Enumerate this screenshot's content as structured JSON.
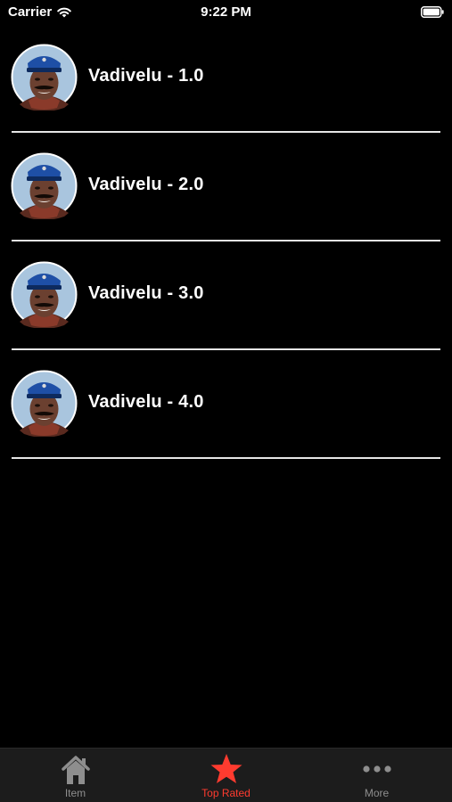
{
  "status_bar": {
    "carrier": "Carrier",
    "time": "9:22 PM"
  },
  "items": [
    {
      "label": "Vadivelu - 1.0"
    },
    {
      "label": "Vadivelu - 2.0"
    },
    {
      "label": "Vadivelu - 3.0"
    },
    {
      "label": "Vadivelu - 4.0"
    }
  ],
  "tab_bar": {
    "tabs": [
      {
        "label": "Item",
        "icon": "home-icon",
        "active": false
      },
      {
        "label": "Top Rated",
        "icon": "star-icon",
        "active": true
      },
      {
        "label": "More",
        "icon": "more-icon",
        "active": false
      }
    ],
    "active_color": "#ff3b2f",
    "inactive_color": "#8e8e8e"
  }
}
